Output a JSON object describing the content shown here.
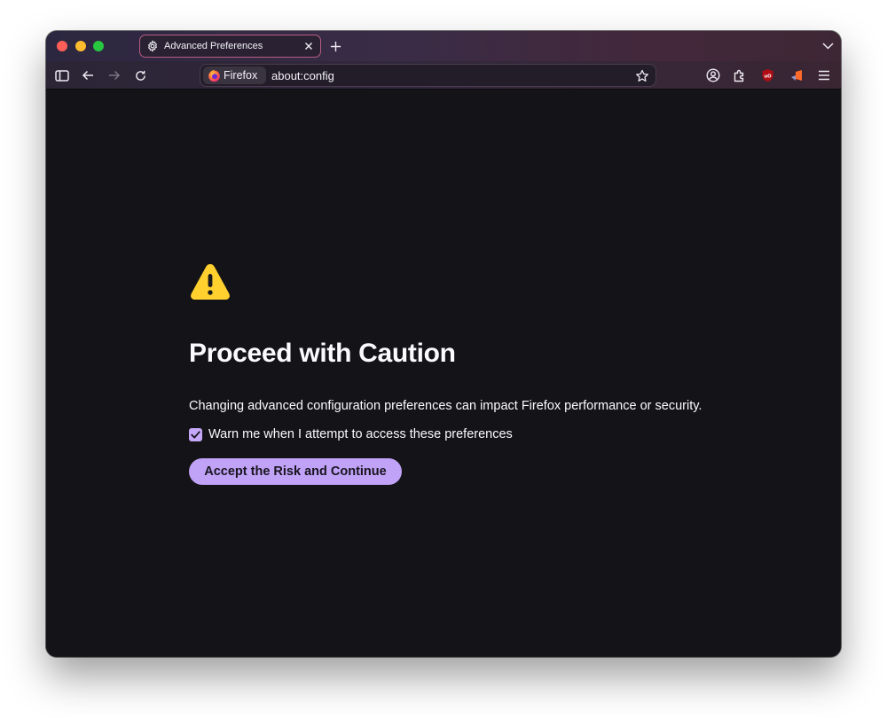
{
  "browser": {
    "tab": {
      "title": "Advanced Preferences",
      "icon": "gear-icon",
      "close_icon": "close-icon"
    },
    "new_tab_icon": "plus-icon",
    "tab_list_icon": "chevron-down-icon",
    "toolbar": {
      "left_buttons": [
        "sidebar-icon",
        "back-arrow-icon",
        "forward-arrow-icon",
        "reload-icon"
      ],
      "right_buttons": [
        "account-icon",
        "extensions-icon",
        "ublock-origin-icon",
        "extension-icon",
        "menu-icon"
      ]
    },
    "urlbar": {
      "identity_label": "Firefox",
      "url": "about:config",
      "bookmark_icon": "star-icon"
    }
  },
  "page": {
    "icon": "warning-icon",
    "title": "Proceed with Caution",
    "description": "Changing advanced configuration preferences can impact Firefox performance or security.",
    "checkbox": {
      "label": "Warn me when I attempt to access these preferences",
      "checked": true
    },
    "accept_button": "Accept the Risk and Continue"
  },
  "colors": {
    "accent": "#c0a2f7",
    "warning": "#ffd02e",
    "page_background": "#141317",
    "text": "#fbfbfe"
  }
}
